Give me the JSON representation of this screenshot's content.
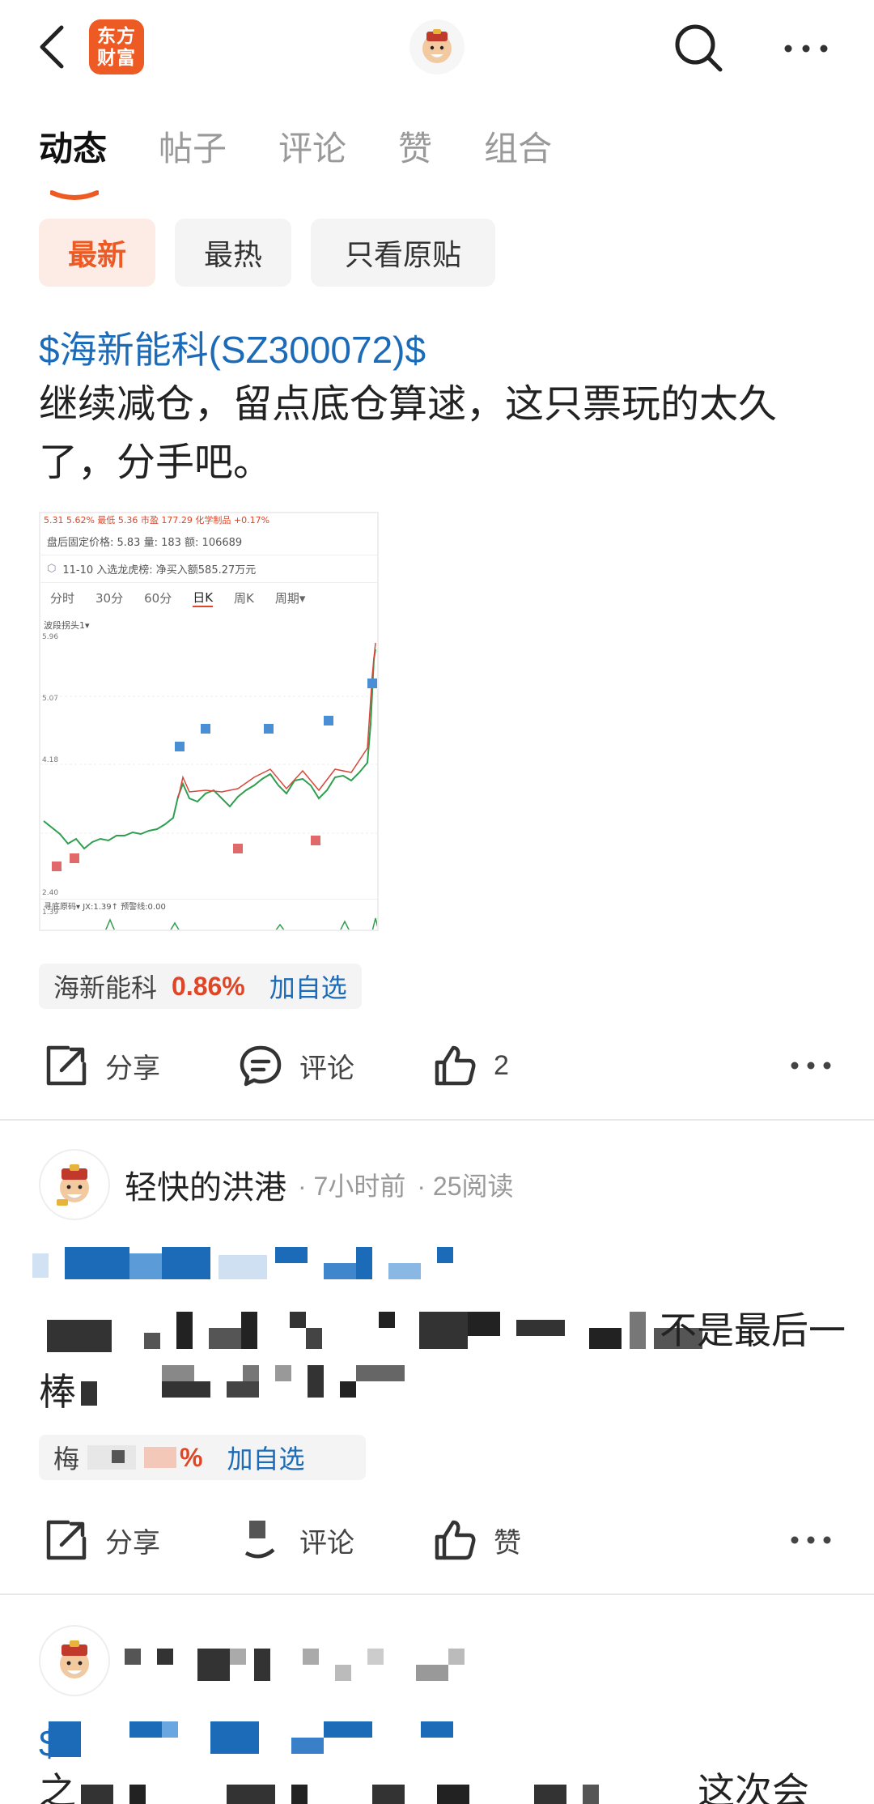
{
  "header": {
    "logo_line1": "东方",
    "logo_line2": "财富",
    "back_icon": "chevron-left-icon",
    "search_icon": "search-icon",
    "more_icon": "more-horizontal-icon"
  },
  "tabs": [
    {
      "label": "动态",
      "active": true
    },
    {
      "label": "帖子",
      "active": false
    },
    {
      "label": "评论",
      "active": false
    },
    {
      "label": "赞",
      "active": false
    },
    {
      "label": "组合",
      "active": false
    }
  ],
  "filters": [
    {
      "label": "最新",
      "active": true
    },
    {
      "label": "最热",
      "active": false
    },
    {
      "label": "只看原贴",
      "active": false
    }
  ],
  "post1": {
    "stock_link": "$海新能科(SZ300072)$",
    "text": "继续减仓，留点底仓算逑，这只票玩的太久了，分手吧。",
    "chart_thumb": {
      "top_row": "5.31  5.62%      最低   5.36  市盈   177.29  化学制品  +0.17%",
      "after_hours": "盘后固定价格: 5.83   量: 183   额: 106689",
      "dragon_tiger": "11-10 入选龙虎榜: 净买入额585.27万元",
      "periods": [
        "分时",
        "30分",
        "60分",
        "日K",
        "周K",
        "周期▾"
      ],
      "selected_period": "日K",
      "indicator_tag": "波段拐头1▾",
      "price_labels": [
        "5.96",
        "5.07",
        "4.18",
        "2.40",
        "1.39"
      ],
      "bottom_tag": "寻底原码▾  JX:1.39↑ 预警线:0.00"
    },
    "stock_pill": {
      "name": "海新能科",
      "change": "0.86%",
      "add_label": "加自选"
    },
    "actions": {
      "share": "分享",
      "comment": "评论",
      "like_count": "2"
    }
  },
  "post2": {
    "author": "轻快的洪港",
    "time": "· 7小时前",
    "reads": "· 25阅读",
    "text_visible_tail": "不是最后一",
    "text_line2_head": "棒",
    "stock_pill": {
      "name_head": "梅",
      "change_tail": "%",
      "add_label": "加自选"
    },
    "actions": {
      "share": "分享",
      "comment": "评论",
      "like": "赞"
    }
  },
  "post3": {
    "stock_head": "$",
    "text_head": "之",
    "text_tail": "这次会"
  },
  "colors": {
    "brand": "#ee5a24",
    "link": "#1c6bb8",
    "up_red": "#e04526"
  }
}
